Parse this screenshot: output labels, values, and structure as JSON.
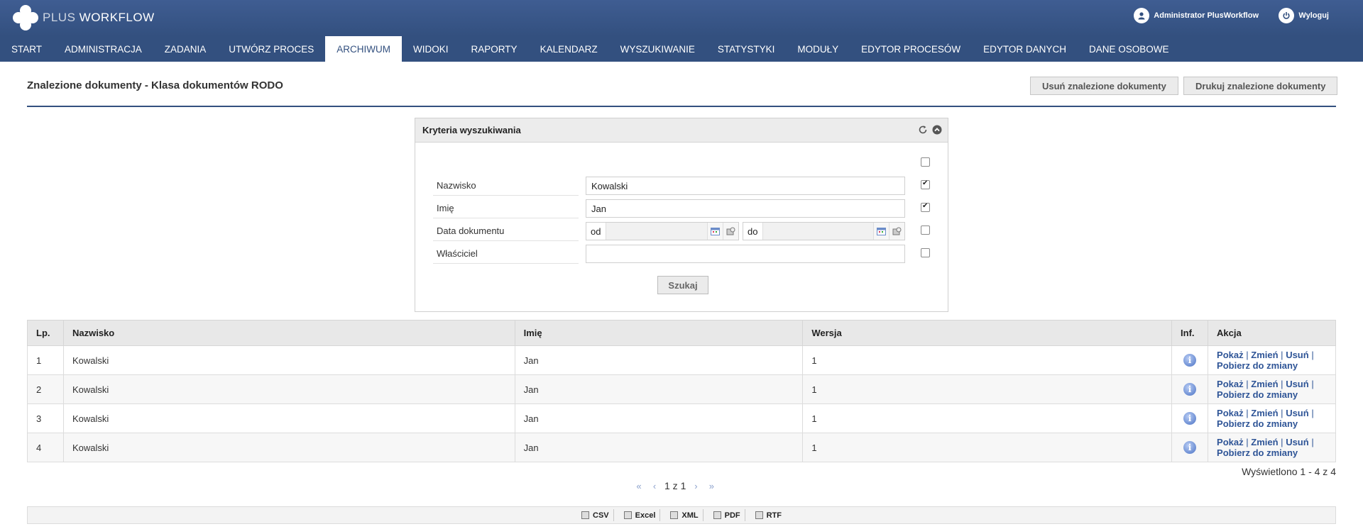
{
  "app": {
    "logo_plus": "PLUS",
    "logo_workflow": "WORKFLOW",
    "user_name": "Administrator PlusWorkflow",
    "logout_label": "Wyloguj"
  },
  "nav": {
    "items": [
      "START",
      "ADMINISTRACJA",
      "ZADANIA",
      "UTWÓRZ PROCES",
      "ARCHIWUM",
      "WIDOKI",
      "RAPORTY",
      "KALENDARZ",
      "WYSZUKIWANIE",
      "STATYSTYKI",
      "MODUŁY",
      "EDYTOR PROCESÓW",
      "EDYTOR DANYCH",
      "DANE OSOBOWE"
    ],
    "active_index": 4
  },
  "page": {
    "title": "Znalezione dokumenty - Klasa dokumentów RODO",
    "delete_btn": "Usuń znalezione dokumenty",
    "print_btn": "Drukuj znalezione dokumenty"
  },
  "search": {
    "panel_title": "Kryteria wyszukiwania",
    "fields": {
      "surname_label": "Nazwisko",
      "surname_value": "Kowalski",
      "name_label": "Imię",
      "name_value": "Jan",
      "date_label": "Data dokumentu",
      "date_from": "od",
      "date_to": "do",
      "owner_label": "Właściciel",
      "owner_value": ""
    },
    "checkboxes": {
      "all": false,
      "surname": true,
      "name": true,
      "date": false,
      "owner": false
    },
    "submit_label": "Szukaj"
  },
  "table": {
    "headers": {
      "lp": "Lp.",
      "surname": "Nazwisko",
      "name": "Imię",
      "version": "Wersja",
      "info": "Inf.",
      "action": "Akcja"
    },
    "rows": [
      {
        "lp": "1",
        "surname": "Kowalski",
        "name": "Jan",
        "version": "1"
      },
      {
        "lp": "2",
        "surname": "Kowalski",
        "name": "Jan",
        "version": "1"
      },
      {
        "lp": "3",
        "surname": "Kowalski",
        "name": "Jan",
        "version": "1"
      },
      {
        "lp": "4",
        "surname": "Kowalski",
        "name": "Jan",
        "version": "1"
      }
    ],
    "actions": {
      "show": "Pokaż",
      "change": "Zmień",
      "delete": "Usuń",
      "checkout": "Pobierz do zmiany"
    }
  },
  "pager": {
    "page_text": "1 z 1",
    "shown_text": "Wyświetlono 1 - 4 z 4"
  },
  "export": {
    "csv": "CSV",
    "excel": "Excel",
    "xml": "XML",
    "pdf": "PDF",
    "rtf": "RTF"
  },
  "colors": {
    "brand": "#33507f",
    "link": "#2f5597"
  }
}
